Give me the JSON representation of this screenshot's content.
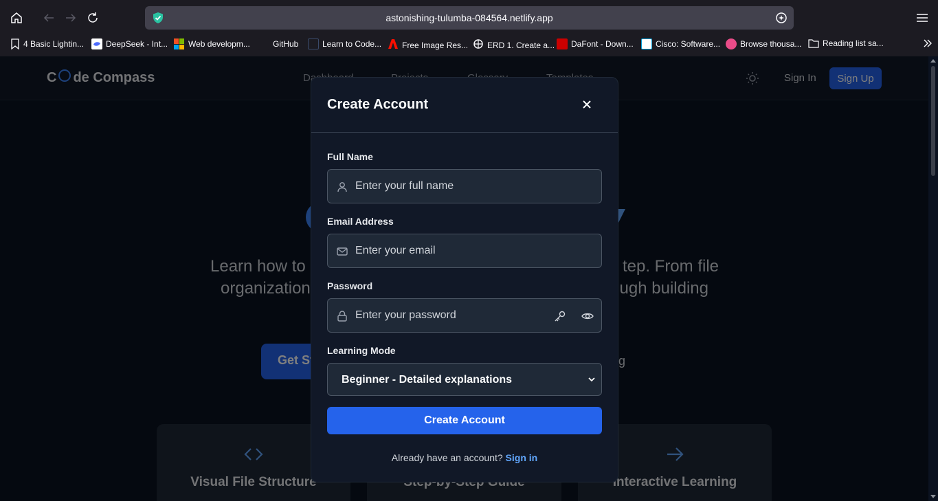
{
  "browser": {
    "url": "astonishing-tulumba-084564.netlify.app",
    "bookmarks": [
      {
        "label": "4 Basic Lightin...",
        "icon": "bookmark-icon"
      },
      {
        "label": "DeepSeek - Int...",
        "icon": "deepseek-icon"
      },
      {
        "label": "Web developm...",
        "icon": "microsoft-icon"
      },
      {
        "label": "GitHub",
        "icon": "github-icon"
      },
      {
        "label": "Learn to Code...",
        "icon": "page-icon"
      },
      {
        "label": "Free Image Res...",
        "icon": "adobe-icon"
      },
      {
        "label": "ERD 1. Create a...",
        "icon": "erd-icon"
      },
      {
        "label": "DaFont - Down...",
        "icon": "dafont-icon"
      },
      {
        "label": "Cisco: Software...",
        "icon": "cisco-icon"
      },
      {
        "label": "Browse thousa...",
        "icon": "dribbble-icon"
      },
      {
        "label": "Reading list sa...",
        "icon": "folder-icon"
      }
    ]
  },
  "site": {
    "logo": {
      "left": "C",
      "right": "de Compass"
    },
    "nav": [
      "Dashboard",
      "Projects",
      "Glossary",
      "Templates"
    ],
    "sign_in": "Sign In",
    "sign_up": "Sign Up",
    "hero_line1_left": "Learn how to",
    "hero_line1_right": "tep. From file",
    "hero_line2_left": "organization",
    "hero_line2_right": "ugh building",
    "get_started": "Get St",
    "learning_link": "arning",
    "cards": [
      "Visual File Structure",
      "Step-by-Step Guide",
      "Interactive Learning"
    ]
  },
  "modal": {
    "title": "Create Account",
    "full_name_label": "Full Name",
    "full_name_placeholder": "Enter your full name",
    "email_label": "Email Address",
    "email_placeholder": "Enter your email",
    "password_label": "Password",
    "password_placeholder": "Enter your password",
    "mode_label": "Learning Mode",
    "mode_value": "Beginner - Detailed explanations",
    "submit": "Create Account",
    "footer_text": "Already have an account?",
    "footer_link": "Sign in"
  },
  "colors": {
    "accent": "#2563eb",
    "link": "#60a5fa",
    "modal_bg": "#111827",
    "page_bg": "#0b1220"
  }
}
